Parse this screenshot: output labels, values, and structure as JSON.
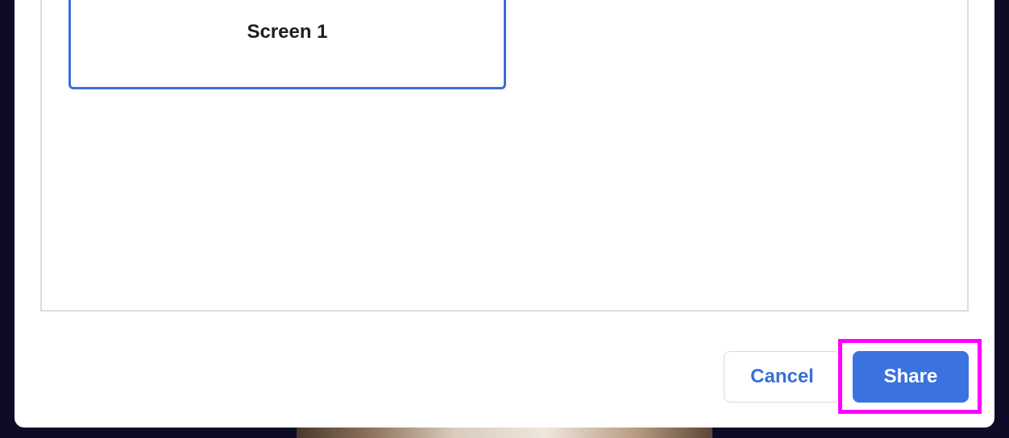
{
  "screen_picker": {
    "tiles": [
      {
        "label": "Screen 1",
        "selected": true
      }
    ]
  },
  "actions": {
    "cancel_label": "Cancel",
    "share_label": "Share"
  },
  "colors": {
    "accent": "#3a72df",
    "highlight": "#ff00ff",
    "backdrop": "#0d0b26"
  }
}
